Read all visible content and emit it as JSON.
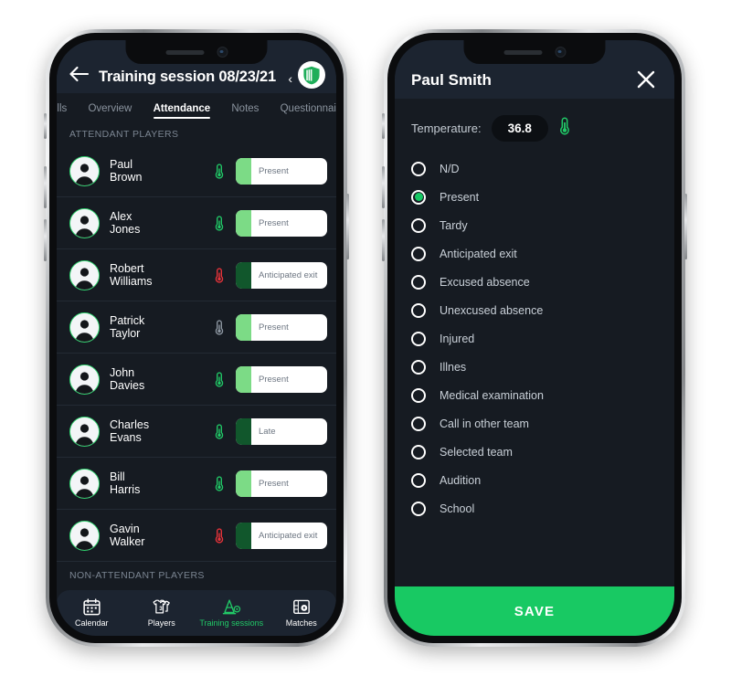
{
  "colors": {
    "screen_bg": "#161b22",
    "header_bg": "#1c2430",
    "accent_green": "#18c963",
    "pill_green_light": "#7cdb86",
    "pill_green_dark": "#11572c",
    "thermo_green": "#21c967",
    "thermo_red": "#e8333a",
    "thermo_gray": "#8d97a2",
    "muted_text": "#8a939e"
  },
  "left_phone": {
    "header": {
      "back_icon": "arrow-left-icon",
      "title": "Training session 08/23/21",
      "chevron": "‹",
      "logo_icon": "shield-logo-icon"
    },
    "tabs": [
      {
        "label": "rills",
        "active": false
      },
      {
        "label": "Overview",
        "active": false
      },
      {
        "label": "Attendance",
        "active": true
      },
      {
        "label": "Notes",
        "active": false
      },
      {
        "label": "Questionnai",
        "active": false
      }
    ],
    "section_attendant": "ATTENDANT PLAYERS",
    "section_non_attendant": "NON-ATTENDANT PLAYERS",
    "players": [
      {
        "first": "Paul",
        "last": "Brown",
        "thermo": "green",
        "status": "Present",
        "tab": "light"
      },
      {
        "first": "Alex",
        "last": "Jones",
        "thermo": "green",
        "status": "Present",
        "tab": "light"
      },
      {
        "first": "Robert",
        "last": "Williams",
        "thermo": "red",
        "status": "Anticipated exit",
        "tab": "dark"
      },
      {
        "first": "Patrick",
        "last": "Taylor",
        "thermo": "gray",
        "status": "Present",
        "tab": "light"
      },
      {
        "first": "John",
        "last": "Davies",
        "thermo": "green",
        "status": "Present",
        "tab": "light"
      },
      {
        "first": "Charles",
        "last": "Evans",
        "thermo": "green",
        "status": "Late",
        "tab": "dark"
      },
      {
        "first": "Bill",
        "last": "Harris",
        "thermo": "green",
        "status": "Present",
        "tab": "light"
      },
      {
        "first": "Gavin",
        "last": "Walker",
        "thermo": "red",
        "status": "Anticipated exit",
        "tab": "dark"
      }
    ],
    "bottom_nav": [
      {
        "label": "Calendar",
        "icon": "calendar-icon",
        "active": false
      },
      {
        "label": "Players",
        "icon": "jerseys-icon",
        "active": false
      },
      {
        "label": "Training sessions",
        "icon": "training-cone-icon",
        "active": true
      },
      {
        "label": "Matches",
        "icon": "goal-net-icon",
        "active": false
      }
    ]
  },
  "right_phone": {
    "header": {
      "title": "Paul Smith",
      "close_icon": "close-icon"
    },
    "temperature": {
      "label": "Temperature:",
      "value": "36.8",
      "icon": "thermometer-icon"
    },
    "options": [
      {
        "label": "N/D",
        "selected": false
      },
      {
        "label": "Present",
        "selected": true
      },
      {
        "label": "Tardy",
        "selected": false
      },
      {
        "label": "Anticipated exit",
        "selected": false
      },
      {
        "label": "Excused absence",
        "selected": false
      },
      {
        "label": "Unexcused absence",
        "selected": false
      },
      {
        "label": "Injured",
        "selected": false
      },
      {
        "label": "Illnes",
        "selected": false
      },
      {
        "label": "Medical examination",
        "selected": false
      },
      {
        "label": "Call in other team",
        "selected": false
      },
      {
        "label": "Selected team",
        "selected": false
      },
      {
        "label": "Audition",
        "selected": false
      },
      {
        "label": "School",
        "selected": false
      }
    ],
    "save_label": "SAVE"
  }
}
